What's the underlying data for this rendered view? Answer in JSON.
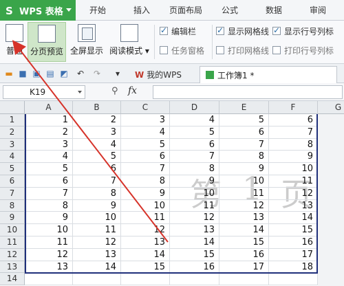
{
  "app": {
    "title": "WPS 表格"
  },
  "menu": {
    "tabs": [
      "开始",
      "插入",
      "页面布局",
      "公式",
      "数据",
      "审阅"
    ]
  },
  "ribbon": {
    "normal_label": "普通",
    "page_break_label": "分页预览",
    "fullscreen_label": "全屏显示",
    "reading_label": "阅读模式",
    "edit_bar_label": "编辑栏",
    "task_pane_label": "任务窗格",
    "show_gridlines_label": "显示网格线",
    "print_gridlines_label": "打印网格线",
    "show_headers_label": "显示行号列标",
    "print_headers_label": "打印行号列标"
  },
  "doc_tabs": {
    "wps": "我的WPS",
    "workbook": "工作簿1 *"
  },
  "formula_bar": {
    "cell_ref": "K19",
    "fx": "fx"
  },
  "watermark": [
    "第",
    "1",
    "页"
  ],
  "columns": [
    "A",
    "B",
    "C",
    "D",
    "E",
    "F",
    "G"
  ],
  "rows": [
    [
      1,
      2,
      3,
      4,
      5,
      6
    ],
    [
      2,
      3,
      4,
      5,
      6,
      7
    ],
    [
      3,
      4,
      5,
      6,
      7,
      8
    ],
    [
      4,
      5,
      6,
      7,
      8,
      9
    ],
    [
      5,
      6,
      7,
      8,
      9,
      10
    ],
    [
      6,
      7,
      8,
      9,
      10,
      11
    ],
    [
      7,
      8,
      9,
      10,
      11,
      12
    ],
    [
      8,
      9,
      10,
      11,
      12,
      13
    ],
    [
      9,
      10,
      11,
      12,
      13,
      14
    ],
    [
      10,
      11,
      12,
      13,
      14,
      15
    ],
    [
      11,
      12,
      13,
      14,
      15,
      16
    ],
    [
      12,
      13,
      14,
      15,
      16,
      17
    ],
    [
      13,
      14,
      15,
      16,
      17,
      18
    ]
  ],
  "extra_row": "14",
  "colors": {
    "accent": "#3aa54a",
    "page_border": "#1f2f7a",
    "annotation_arrow": "#d6332a"
  }
}
